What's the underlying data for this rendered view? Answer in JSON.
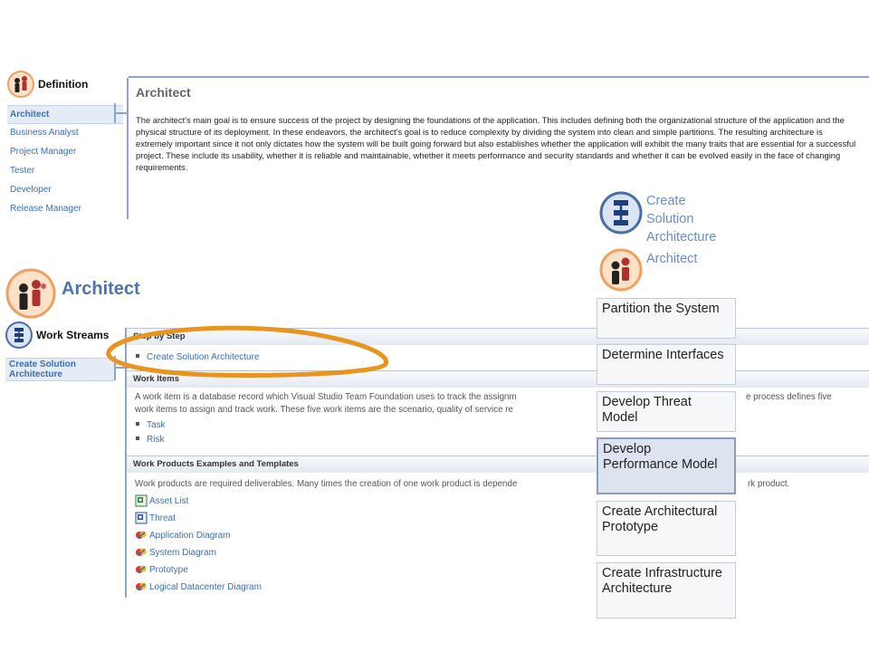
{
  "definition": {
    "heading": "Definition",
    "nav": [
      "Architect",
      "Business Analyst",
      "Project Manager",
      "Tester",
      "Developer",
      "Release Manager"
    ],
    "content_title": "Architect",
    "content_text": "The architect's main goal is to ensure success of the project by designing the foundations of the application. This includes defining both the organizational structure of the application and the physical structure of its deployment. In these endeavors, the architect's goal is to reduce complexity by dividing the system into clean and simple partitions. The resulting architecture is extremely important since it not only dictates how the system will be built going forward but also establishes whether the application will exhibit the many traits that are essential for a successful project. These include its usability, whether it is reliable and maintainable, whether it meets performance and security standards and whether it can be evolved easily in the face of changing requirements."
  },
  "architect": {
    "title": "Architect",
    "work_streams_heading": "Work Streams",
    "work_streams_nav": [
      "Create Solution Architecture"
    ],
    "step_by_step": {
      "heading": "Step by Step",
      "items": [
        "Create Solution Architecture"
      ]
    },
    "work_items": {
      "heading": "Work Items",
      "text": "A work item is a database record which Visual Studio Team Foundation uses to track the assignm",
      "text_right": "e process defines five",
      "text_line2": "work items to assign and track work. These five work items are the scenario, quality of service re",
      "items": [
        "Task",
        "Risk"
      ]
    },
    "work_products": {
      "heading": "Work Products Examples and Templates",
      "text": "Work products are required deliverables. Many times the creation of one work product is depende",
      "text_right": "rk product.",
      "items": [
        {
          "label": "Asset List",
          "icon": "excel-doc-icon"
        },
        {
          "label": "Threat",
          "icon": "word-doc-icon"
        },
        {
          "label": "Application Diagram",
          "icon": "diagram-icon"
        },
        {
          "label": "System Diagram",
          "icon": "diagram-icon"
        },
        {
          "label": "Prototype",
          "icon": "diagram-icon"
        },
        {
          "label": "Logical Datacenter Diagram",
          "icon": "diagram-icon"
        }
      ]
    }
  },
  "overlay": {
    "workstream_label": [
      "Create",
      "Solution",
      "Architecture"
    ],
    "role_label": "Architect",
    "steps": [
      {
        "label": "Partition the System",
        "active": false
      },
      {
        "label": "Determine Interfaces",
        "active": false
      },
      {
        "label": "Develop Threat Model",
        "active": false
      },
      {
        "label": "Develop Performance Model",
        "active": true
      },
      {
        "label": "Create Architectural Prototype",
        "active": false
      },
      {
        "label": "Create Infrastructure Architecture",
        "active": false
      }
    ]
  },
  "colors": {
    "link": "#3a6fb0",
    "accent_rail": "#8fa5c4",
    "highlight_ring": "#e8951f",
    "role_icon_ring": "#f0a060"
  }
}
